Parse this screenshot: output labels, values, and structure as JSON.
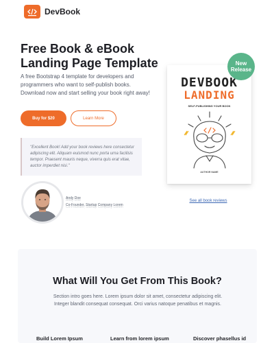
{
  "brand": {
    "name": "DevBook",
    "logo_icon": "code-icon",
    "accent": "#ee6c2a"
  },
  "hero": {
    "title": "Free Book & eBook Landing Page Template",
    "intro": "A free Bootstrap 4 template for developers and programmers who want to self-publish books. Download now and start selling your book right away!",
    "buy_label": "Buy for $20",
    "learn_label": "Learn More"
  },
  "review": {
    "quote": "\"Excellent Book! Add your book reviews here consectetur adipiscing elit. Aliquam euismod nunc porta urna facilisis tempor. Praesent mauris neque, viverra quis erat vitae, auctor imperdiet nisi.\"",
    "author_name": "Andy Doe",
    "author_title": "Co-Founder, Startup Company Lorem"
  },
  "book": {
    "title_line1": "DEVBOOK",
    "title_line2": "LANDING",
    "subtitle": "SELF-PUBLISHING YOUR BOOK",
    "author": "AUTHOR NAME",
    "badge_line1": "New",
    "badge_line2": "Release",
    "badge_color": "#5ab58a",
    "see_all_link": "See all book reviews"
  },
  "section": {
    "title": "What Will You Get From This Book?",
    "intro": "Section intro goes here. Lorem ipsum dolor sit amet, consectetur adipiscing elit. Integer blandit consequat consequat. Orci varius natoque penatibus et magnis.",
    "features": [
      "Build Lorem Ipsum",
      "Learn from lorem ipsum",
      "Discover phasellus id"
    ]
  }
}
